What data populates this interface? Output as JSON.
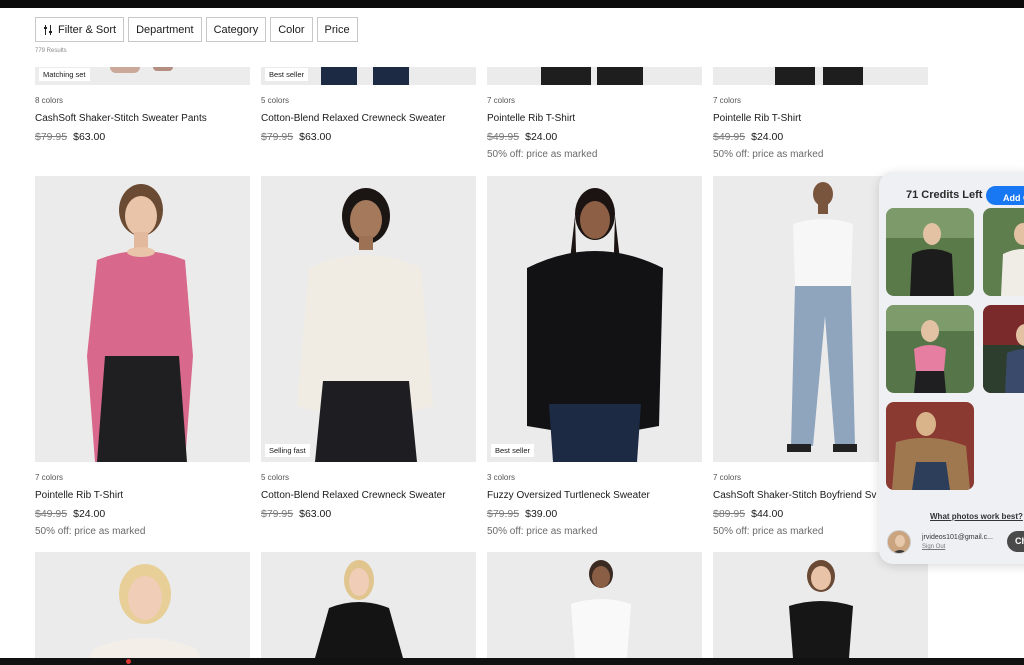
{
  "filters": {
    "filter_sort": "Filter & Sort",
    "department": "Department",
    "category": "Category",
    "color": "Color",
    "price": "Price",
    "results": "779 Results"
  },
  "row1": [
    {
      "badge": "Matching set",
      "colors": "8 colors",
      "name": "CashSoft Shaker-Stitch Sweater Pants",
      "old_price": "$79.95",
      "price": "$63.00",
      "promo": ""
    },
    {
      "badge": "Best seller",
      "colors": "5 colors",
      "name": "Cotton-Blend Relaxed Crewneck Sweater",
      "old_price": "$79.95",
      "price": "$63.00",
      "promo": ""
    },
    {
      "badge": "",
      "colors": "7 colors",
      "name": "Pointelle Rib T-Shirt",
      "old_price": "$49.95",
      "price": "$24.00",
      "promo": "50% off: price as marked"
    },
    {
      "badge": "",
      "colors": "7 colors",
      "name": "Pointelle Rib T-Shirt",
      "old_price": "$49.95",
      "price": "$24.00",
      "promo": "50% off: price as marked"
    }
  ],
  "row2": [
    {
      "badge": "",
      "colors": "7 colors",
      "name": "Pointelle Rib T-Shirt",
      "old_price": "$49.95",
      "price": "$24.00",
      "promo": "50% off: price as marked"
    },
    {
      "badge": "Selling fast",
      "colors": "5 colors",
      "name": "Cotton-Blend Relaxed Crewneck Sweater",
      "old_price": "$79.95",
      "price": "$63.00",
      "promo": ""
    },
    {
      "badge": "Best seller",
      "colors": "3 colors",
      "name": "Fuzzy Oversized Turtleneck Sweater",
      "old_price": "$79.95",
      "price": "$39.00",
      "promo": "50% off: price as marked"
    },
    {
      "badge": "",
      "colors": "7 colors",
      "name": "CashSoft Shaker-Stitch Boyfriend Sv",
      "old_price": "$89.95",
      "price": "$44.00",
      "promo": "50% off: price as marked"
    }
  ],
  "panel": {
    "title": "71 Credits Left",
    "add_button": "Add Cre",
    "help_link": "What photos work best?",
    "email": "jrvideos101@gmail.c...",
    "sign_out": "Sign Out",
    "action_button": "Ch"
  },
  "icons": {
    "filter": "sliders-icon"
  },
  "colors": {
    "accent": "#1877f2",
    "panel_bg": "#eef0f4"
  }
}
